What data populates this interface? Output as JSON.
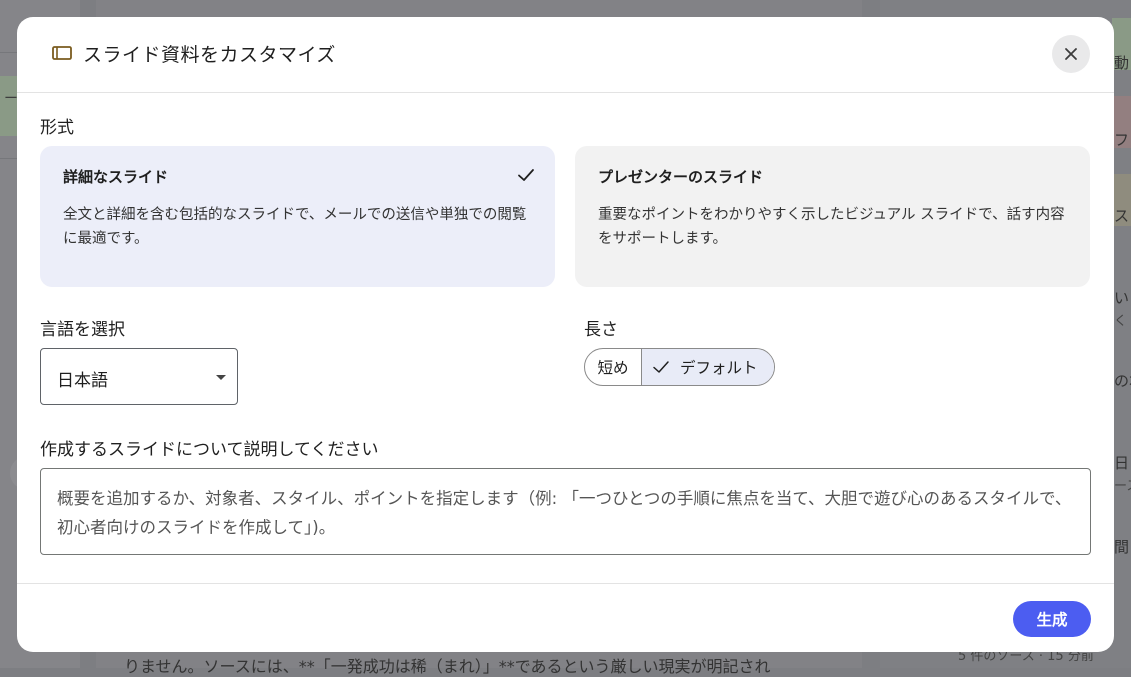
{
  "modal": {
    "title": "スライド資料をカスタマイズ",
    "close_icon": "close-icon",
    "format_label": "形式",
    "formats": [
      {
        "title": "詳細なスライド",
        "description": "全文と詳細を含む包括的なスライドで、メールでの送信や単独での閲覧に最適です。",
        "selected": true
      },
      {
        "title": "プレゼンターのスライド",
        "description": "重要なポイントをわかりやすく示したビジュアル スライドで、話す内容をサポートします。",
        "selected": false
      }
    ],
    "language_label": "言語を選択",
    "language_value": "日本語",
    "length_label": "長さ",
    "length_options": [
      "短め",
      "デフォルト"
    ],
    "length_selected": "デフォルト",
    "description_label": "作成するスライドについて説明してください",
    "description_placeholder": "概要を追加するか、対象者、スタイル、ポイントを指定します（例: 「一つひとつの手順に焦点を当て、大胆で遊び心のあるスタイルで、初心者向けのスライドを作成して」)。",
    "generate_label": "生成"
  },
  "background": {
    "left_fragment": "ート",
    "bottom_text": "りません。ソースには、**「一発成功は稀（まれ）」**であるという厳しい現実が明記され",
    "right_fragments": [
      "動",
      "フ",
      "ス",
      "いま",
      "く",
      "の本",
      "日",
      "ース",
      "間"
    ],
    "right_source_note": "5 件のソース · 15 分前"
  },
  "colors": {
    "accent": "#4c5df1",
    "selected_card": "#eceef9",
    "unselected_card": "#f2f2f2"
  }
}
